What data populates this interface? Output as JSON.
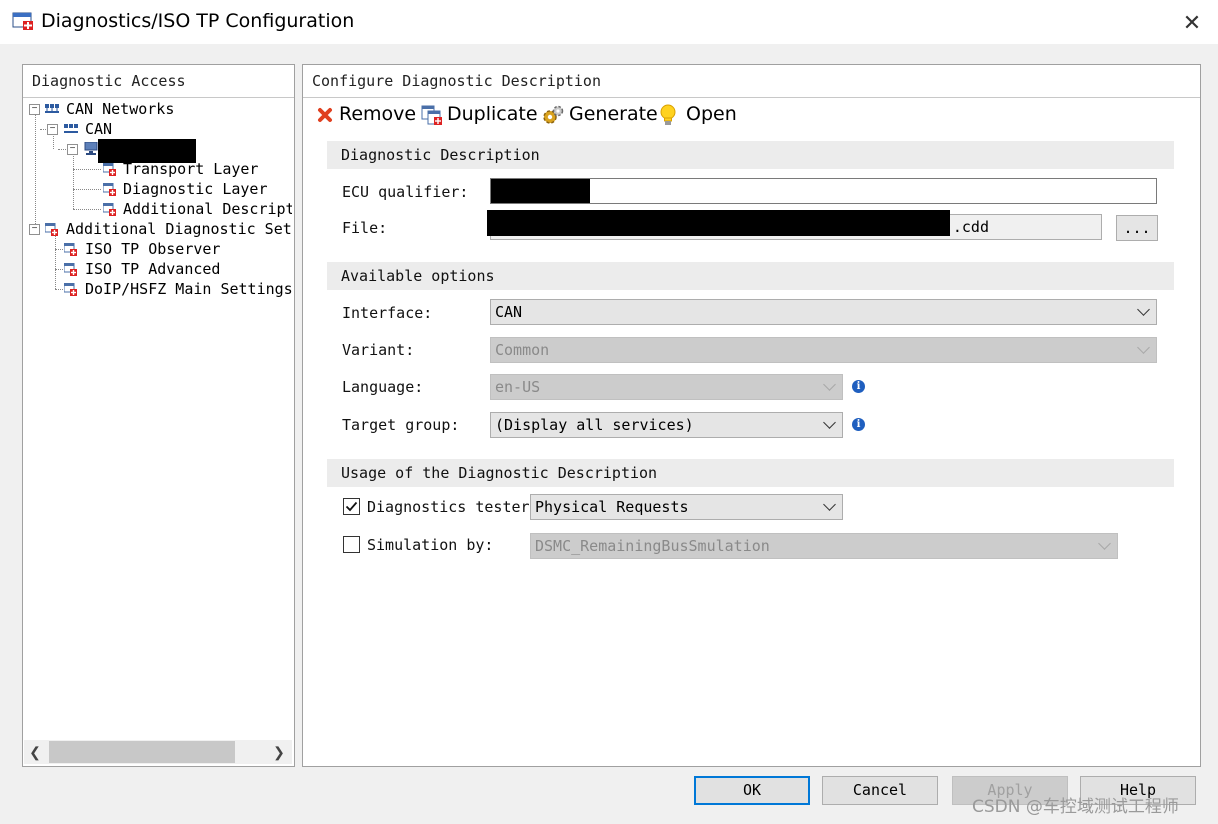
{
  "window": {
    "title": "Diagnostics/ISO TP Configuration",
    "close_glyph": "✕"
  },
  "left_panel": {
    "header": "Diagnostic Access",
    "tree": [
      {
        "label": "CAN Networks",
        "toggle": "−"
      },
      {
        "label": "CAN",
        "toggle": "−"
      },
      {
        "label": "",
        "toggle": "−"
      },
      {
        "label": "Transport Layer"
      },
      {
        "label": "Diagnostic Layer"
      },
      {
        "label": "Additional Descript"
      },
      {
        "label": "Additional Diagnostic Set",
        "toggle": "−"
      },
      {
        "label": "ISO TP Observer"
      },
      {
        "label": "ISO TP Advanced"
      },
      {
        "label": "DoIP/HSFZ Main Settings"
      }
    ],
    "scroll_left": "❮",
    "scroll_right": "❯"
  },
  "right_panel": {
    "header": "Configure Diagnostic Description",
    "toolbar": {
      "remove": "Remove",
      "duplicate": "Duplicate",
      "generate": "Generate",
      "open": "Open"
    },
    "sections": {
      "description": "Diagnostic Description",
      "options": "Available options",
      "usage": "Usage of the Diagnostic Description"
    },
    "fields": {
      "ecu_label": "ECU qualifier:",
      "ecu_value": "",
      "file_label": "File:",
      "file_value": ".cdd",
      "browse_label": "...",
      "interface_label": "Interface:",
      "interface_value": "CAN",
      "variant_label": "Variant:",
      "variant_value": "Common",
      "language_label": "Language:",
      "language_value": "en-US",
      "target_label": "Target group:",
      "target_value": "(Display all services)",
      "info_glyph": "i"
    },
    "usage": {
      "tester_label": "Diagnostics tester",
      "tester_checked": true,
      "tester_value": "Physical Requests",
      "sim_label": "Simulation by:",
      "sim_checked": false,
      "sim_value": "DSMC_RemainingBusSmulation"
    }
  },
  "buttons": {
    "ok": "OK",
    "cancel": "Cancel",
    "apply": "Apply",
    "help": "Help"
  },
  "watermark": "CSDN @车控域测试工程师",
  "colors": {
    "accent": "#0078d7",
    "remove_red": "#e04020",
    "info_blue": "#1f5fbf"
  }
}
